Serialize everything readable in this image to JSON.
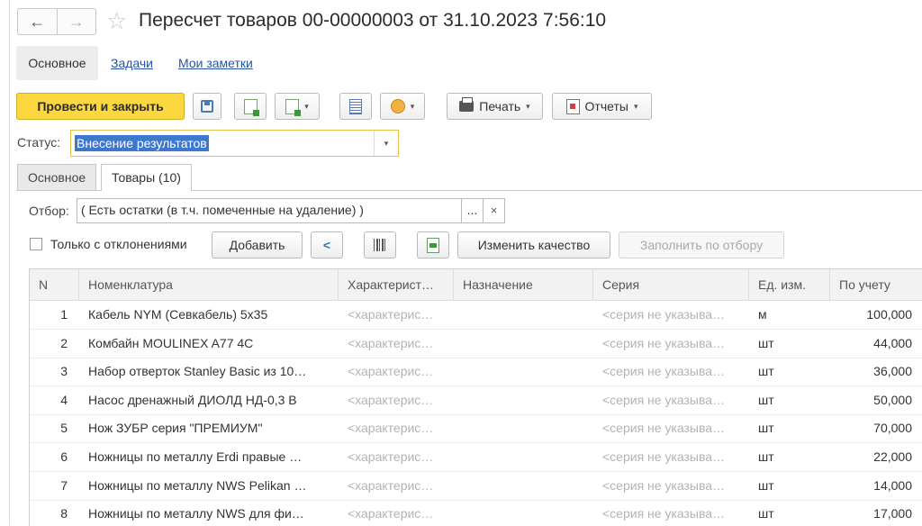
{
  "window": {
    "title": "Пересчет товаров 00-00000003 от 31.10.2023 7:56:10",
    "back_icon": "←",
    "forward_icon": "→",
    "favorite_icon": "☆"
  },
  "section_tabs": {
    "main": "Основное",
    "tasks": "Задачи",
    "notes": "Мои заметки"
  },
  "toolbar": {
    "post_close": "Провести и закрыть",
    "print": "Печать",
    "reports": "Отчеты",
    "caret": "▾"
  },
  "status": {
    "label": "Статус:",
    "value": "Внесение результатов",
    "arrow": "▾"
  },
  "tabs": {
    "main": "Основное",
    "goods": "Товары (10)"
  },
  "filter": {
    "label": "Отбор:",
    "value": "( Есть остатки (в т.ч. помеченные на удаление) )",
    "select": "...",
    "clear": "×"
  },
  "goods_toolbar": {
    "only_deviations": "Только с отклонениями",
    "add": "Добавить",
    "change_quality": "Изменить качество",
    "fill_by_filter": "Заполнить по отбору"
  },
  "table": {
    "headers": {
      "n": "N",
      "item": "Номенклатура",
      "characteristic": "Характерист…",
      "purpose": "Назначение",
      "series": "Серия",
      "unit": "Ед. изм.",
      "accounted": "По учету"
    },
    "rows": [
      {
        "n": "1",
        "item": "Кабель NYM (Севкабель) 5х35",
        "characteristic": "<характерис…",
        "purpose": "",
        "series": "<серия не указыва…",
        "unit": "м",
        "accounted": "100,000"
      },
      {
        "n": "2",
        "item": "Комбайн MOULINEX  A77 4C",
        "characteristic": "<характерис…",
        "purpose": "",
        "series": "<серия не указыва…",
        "unit": "шт",
        "accounted": "44,000"
      },
      {
        "n": "3",
        "item": "Набор отверток Stanley Basic из 10…",
        "characteristic": "<характерис…",
        "purpose": "",
        "series": "<серия не указыва…",
        "unit": "шт",
        "accounted": "36,000"
      },
      {
        "n": "4",
        "item": "Насос дренажный ДИОЛД НД-0,3 В",
        "characteristic": "<характерис…",
        "purpose": "",
        "series": "<серия не указыва…",
        "unit": "шт",
        "accounted": "50,000"
      },
      {
        "n": "5",
        "item": "Нож ЗУБР серия \"ПРЕМИУМ\"",
        "characteristic": "<характерис…",
        "purpose": "",
        "series": "<серия не указыва…",
        "unit": "шт",
        "accounted": "70,000"
      },
      {
        "n": "6",
        "item": "Ножницы по металлу Erdi правые …",
        "characteristic": "<характерис…",
        "purpose": "",
        "series": "<серия не указыва…",
        "unit": "шт",
        "accounted": "22,000"
      },
      {
        "n": "7",
        "item": "Ножницы по металлу NWS Pelikan …",
        "characteristic": "<характерис…",
        "purpose": "",
        "series": "<серия не указыва…",
        "unit": "шт",
        "accounted": "14,000"
      },
      {
        "n": "8",
        "item": "Ножницы по металлу NWS для фи…",
        "characteristic": "<характерис…",
        "purpose": "",
        "series": "<серия не указыва…",
        "unit": "шт",
        "accounted": "17,000"
      }
    ]
  }
}
